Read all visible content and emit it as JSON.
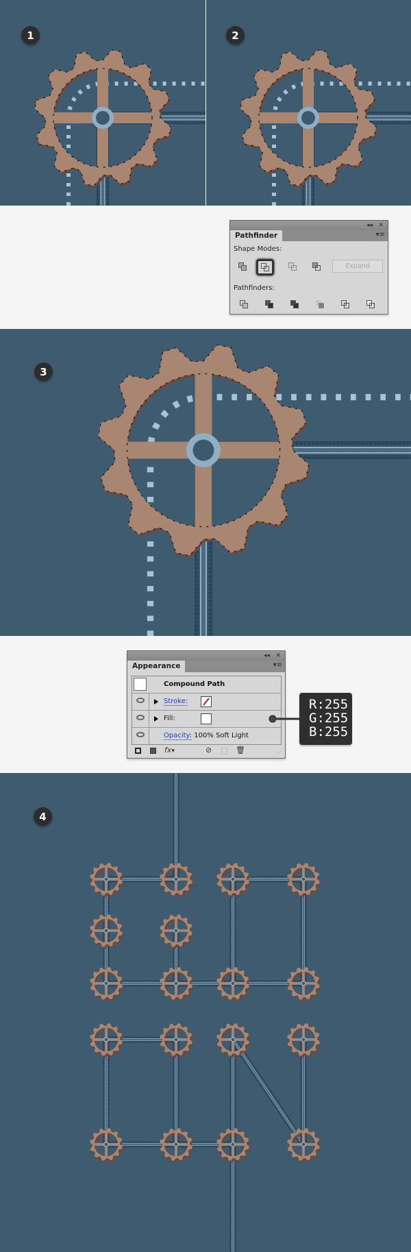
{
  "steps": {
    "s1": "1",
    "s2": "2",
    "s3": "3",
    "s4": "4"
  },
  "colors": {
    "background": "#3f5b6f",
    "gear": "#a88672",
    "gear_shadow": "#6b4a3c",
    "pipe_light": "#8fb0c4",
    "tooltip": "#2f2f2f"
  },
  "pathfinder": {
    "title": "Pathfinder",
    "collapse_icon": "double-chevron-left-icon",
    "close_icon": "close-icon",
    "menu_icon": "panel-menu-icon",
    "shape_modes_label": "Shape Modes:",
    "shape_modes": [
      "unite",
      "minus-front",
      "intersect",
      "exclude"
    ],
    "selected_shape_mode": "minus-front",
    "expand_label": "Expand",
    "pathfinders_label": "Pathfinders:",
    "pathfinders": [
      "divide",
      "trim",
      "merge",
      "crop",
      "outline",
      "minus-back"
    ]
  },
  "appearance": {
    "title": "Appearance",
    "object_label": "Compound Path",
    "stroke_label": "Stroke:",
    "fill_label": "Fill:",
    "opacity_label": "Opacity:",
    "opacity_value": "100% Soft Light",
    "stroke_swatch": "none",
    "fill_swatch": "#ffffff"
  },
  "tooltip": {
    "r": "R:255",
    "g": "G:255",
    "b": "B:255"
  }
}
